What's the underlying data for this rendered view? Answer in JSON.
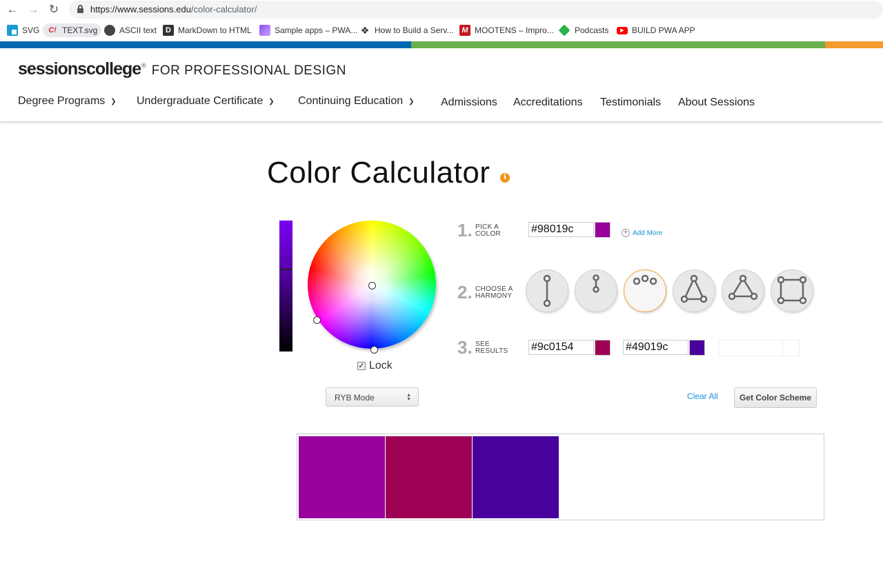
{
  "browser": {
    "url_host": "https://www.sessions.edu",
    "url_path": "/color-calculator/",
    "bookmarks": [
      {
        "label": "SVG",
        "icon": "svg-bookmark-icon",
        "color": "#1a9ad6"
      },
      {
        "label": "TEXT.svg",
        "icon": "codepen-style-icon",
        "color": "#e0263a"
      },
      {
        "label": "ASCII text",
        "icon": "globe-icon",
        "color": "#444444"
      },
      {
        "label": "MarkDown to HTML",
        "icon": "d-letter-icon",
        "color": "#333333"
      },
      {
        "label": "Sample apps – PWA...",
        "icon": "pwa-gradient-icon",
        "color": "#8a4df0"
      },
      {
        "label": "How to Build a Serv...",
        "icon": "codepen-cube-icon",
        "color": "#333333"
      },
      {
        "label": "MOOTENS – Impro...",
        "icon": "m-letter-icon",
        "color": "#c4161c"
      },
      {
        "label": "Podcasts",
        "icon": "feedly-icon",
        "color": "#2bb24c"
      },
      {
        "label": "BUILD PWA APP",
        "icon": "youtube-icon",
        "color": "#ff0000"
      }
    ]
  },
  "site": {
    "logo_brand": "sessionscollege",
    "logo_reg": "®",
    "logo_tagline": "FOR PROFESSIONAL DESIGN",
    "nav": [
      {
        "label": "Degree Programs",
        "dropdown": true
      },
      {
        "label": "Undergraduate Certificate",
        "dropdown": true
      },
      {
        "label": "Continuing Education",
        "dropdown": true
      },
      {
        "label": "Admissions",
        "dropdown": false
      },
      {
        "label": "Accreditations",
        "dropdown": false
      },
      {
        "label": "Testimonials",
        "dropdown": false
      },
      {
        "label": "About Sessions",
        "dropdown": false
      }
    ],
    "brand_colors": [
      "#0067b1",
      "#6ab04c",
      "#f39c2d"
    ]
  },
  "calculator": {
    "title": "Color Calculator",
    "info_icon": "i",
    "lock_label": "Lock",
    "lock_checked": true,
    "mode_select": "RYB Mode",
    "step1": {
      "num": "1.",
      "line1": "PICK A",
      "line2": "COLOR",
      "hex": "#98019c",
      "swatch": "#98019c",
      "add_more": "Add More"
    },
    "step2": {
      "num": "2.",
      "line1": "CHOOSE A",
      "line2": "HARMONY",
      "selected_index": 2,
      "harmonies": [
        "complementary",
        "split-complementary",
        "analogous",
        "triadic",
        "tetradic-triangle",
        "square"
      ]
    },
    "step3": {
      "num": "3.",
      "line1": "SEE",
      "line2": "RESULTS",
      "results": [
        {
          "hex": "#9c0154",
          "swatch": "#9c0154"
        },
        {
          "hex": "#49019c",
          "swatch": "#49019c"
        }
      ]
    },
    "clear_all": "Clear All",
    "get_scheme": "Get Color Scheme",
    "scheme_colors": [
      "#98019c",
      "#9c0154",
      "#49019c"
    ]
  }
}
